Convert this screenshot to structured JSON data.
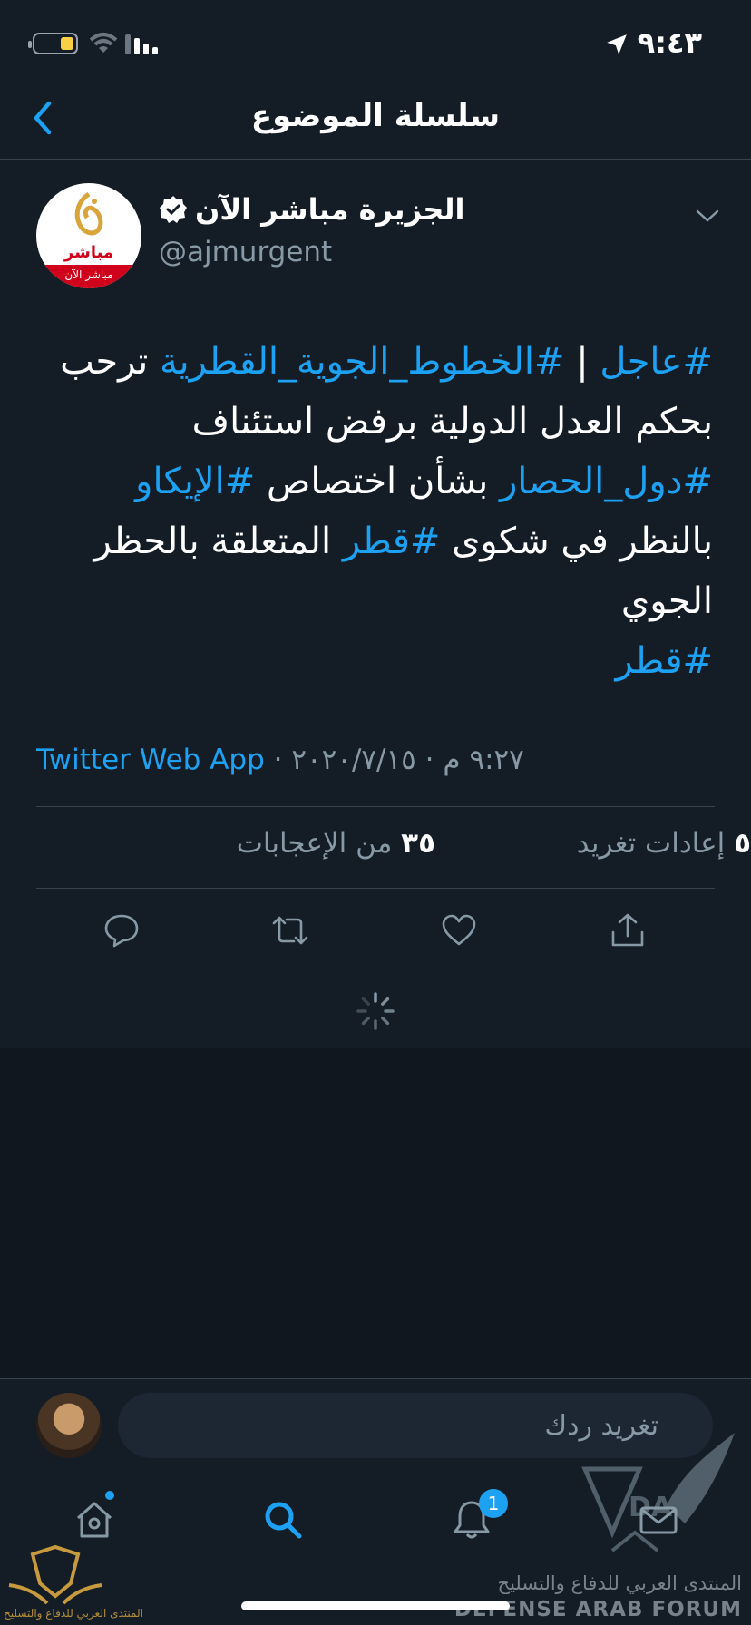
{
  "status_bar": {
    "time": "٩:٤٣"
  },
  "header": {
    "title": "سلسلة الموضوع"
  },
  "author": {
    "name": "الجزيرة مباشر الآن",
    "handle": "@ajmurgent",
    "avatar_text": "مباشر",
    "avatar_bar_text": "مباشر الآن"
  },
  "tweet": {
    "segments": [
      {
        "text": "#عاجل",
        "hashtag": true
      },
      {
        "text": " | ",
        "hashtag": false
      },
      {
        "text": "#الخطوط_الجوية_القطرية",
        "hashtag": true
      },
      {
        "text": " ترحب بحكم العدل الدولية برفض استئناف ",
        "hashtag": false
      },
      {
        "text": "#دول_الحصار",
        "hashtag": true
      },
      {
        "text": " بشأن اختصاص ",
        "hashtag": false
      },
      {
        "text": "#الإيكاو",
        "hashtag": true
      },
      {
        "text": " بالنظر في شكوى ",
        "hashtag": false
      },
      {
        "text": "#قطر",
        "hashtag": true
      },
      {
        "text": " المتعلقة بالحظر الجوي",
        "hashtag": false
      },
      {
        "text": "\n",
        "hashtag": false
      },
      {
        "text": "#قطر",
        "hashtag": true
      }
    ],
    "time": "٩:٢٧ م",
    "date": "٢٠٢٠/٧/١٥",
    "separator": "·",
    "source": "Twitter Web App"
  },
  "stats": {
    "likes_count": "٣٥",
    "likes_label": "من الإعجابات",
    "retweets_count": "٥",
    "retweets_label": "إعادات تغريد"
  },
  "reply": {
    "placeholder": "تغريد ردك"
  },
  "tabs": {
    "notifications_badge": "1"
  },
  "watermark": {
    "arabic": "المنتدى العربي للدفاع والتسليح",
    "english": "DEFENSE ARAB FORUM",
    "left_text": "المنتدى العربي للدفاع والتسليح",
    "initials": "DAF"
  },
  "colors": {
    "accent": "#1da1f2",
    "background": "#141d26",
    "muted": "#8899a6",
    "divider": "#38444d"
  }
}
